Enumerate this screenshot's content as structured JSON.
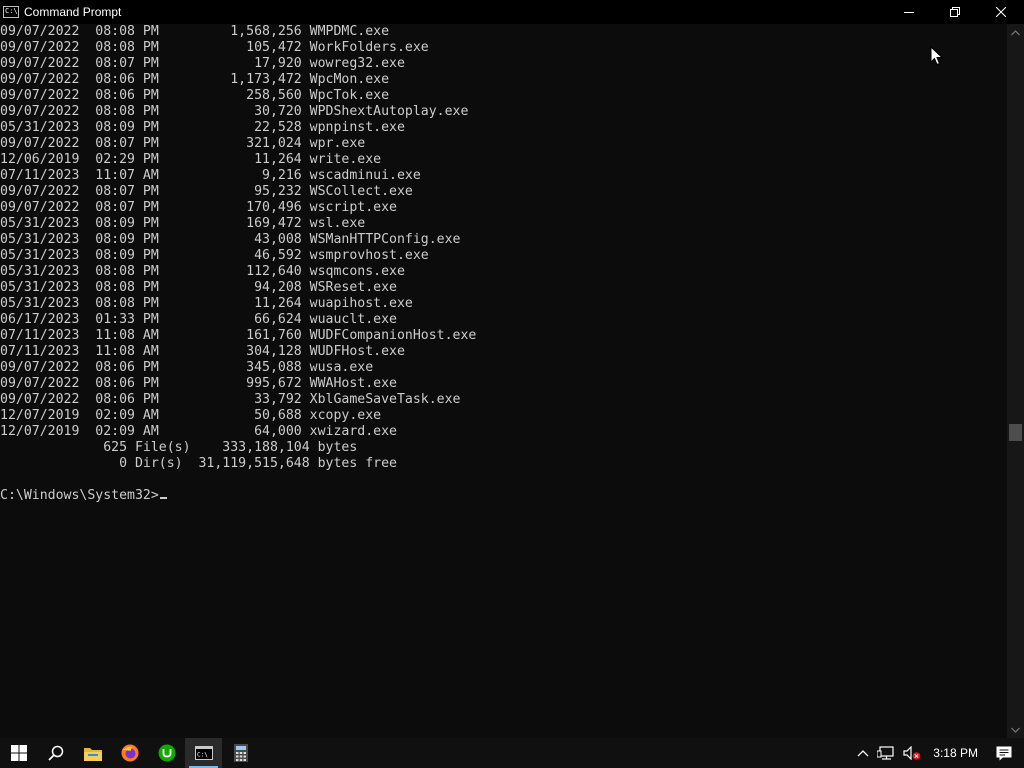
{
  "window": {
    "title": "Command Prompt",
    "controls": [
      "minimize",
      "restore",
      "close"
    ]
  },
  "console": {
    "lines": [
      "09/07/2022  08:08 PM         1,568,256 WMPDMC.exe",
      "09/07/2022  08:08 PM           105,472 WorkFolders.exe",
      "09/07/2022  08:07 PM            17,920 wowreg32.exe",
      "09/07/2022  08:06 PM         1,173,472 WpcMon.exe",
      "09/07/2022  08:06 PM           258,560 WpcTok.exe",
      "09/07/2022  08:08 PM            30,720 WPDShextAutoplay.exe",
      "05/31/2023  08:09 PM            22,528 wpnpinst.exe",
      "09/07/2022  08:07 PM           321,024 wpr.exe",
      "12/06/2019  02:29 PM            11,264 write.exe",
      "07/11/2023  11:07 AM             9,216 wscadminui.exe",
      "09/07/2022  08:07 PM            95,232 WSCollect.exe",
      "09/07/2022  08:07 PM           170,496 wscript.exe",
      "05/31/2023  08:09 PM           169,472 wsl.exe",
      "05/31/2023  08:09 PM            43,008 WSManHTTPConfig.exe",
      "05/31/2023  08:09 PM            46,592 wsmprovhost.exe",
      "05/31/2023  08:08 PM           112,640 wsqmcons.exe",
      "05/31/2023  08:08 PM            94,208 WSReset.exe",
      "05/31/2023  08:08 PM            11,264 wuapihost.exe",
      "06/17/2023  01:33 PM            66,624 wuauclt.exe",
      "07/11/2023  11:08 AM           161,760 WUDFCompanionHost.exe",
      "07/11/2023  11:08 AM           304,128 WUDFHost.exe",
      "09/07/2022  08:06 PM           345,088 wusa.exe",
      "09/07/2022  08:06 PM           995,672 WWAHost.exe",
      "09/07/2022  08:06 PM            33,792 XblGameSaveTask.exe",
      "12/07/2019  02:09 AM            50,688 xcopy.exe",
      "12/07/2019  02:09 AM            64,000 xwizard.exe",
      "             625 File(s)    333,188,104 bytes",
      "               0 Dir(s)  31,119,515,648 bytes free",
      "",
      "C:\\Windows\\System32>"
    ]
  },
  "taskbar": {
    "items": [
      {
        "name": "start-icon"
      },
      {
        "name": "search-icon"
      },
      {
        "name": "file-explorer-icon"
      },
      {
        "name": "firefox-icon"
      },
      {
        "name": "upwork-icon"
      },
      {
        "name": "command-prompt-icon",
        "active": true
      },
      {
        "name": "calculator-icon"
      }
    ],
    "tray": {
      "icons": [
        "chevron-up-icon",
        "network-icon",
        "volume-muted-icon"
      ],
      "time": "3:18 PM",
      "notification_icon": "action-center-icon"
    }
  },
  "colors": {
    "console_bg": "#0c0c0c",
    "console_fg": "#cccccc",
    "titlebar_bg": "#000000",
    "taskbar_bg": "#101010",
    "accent": "#76b9ed"
  }
}
